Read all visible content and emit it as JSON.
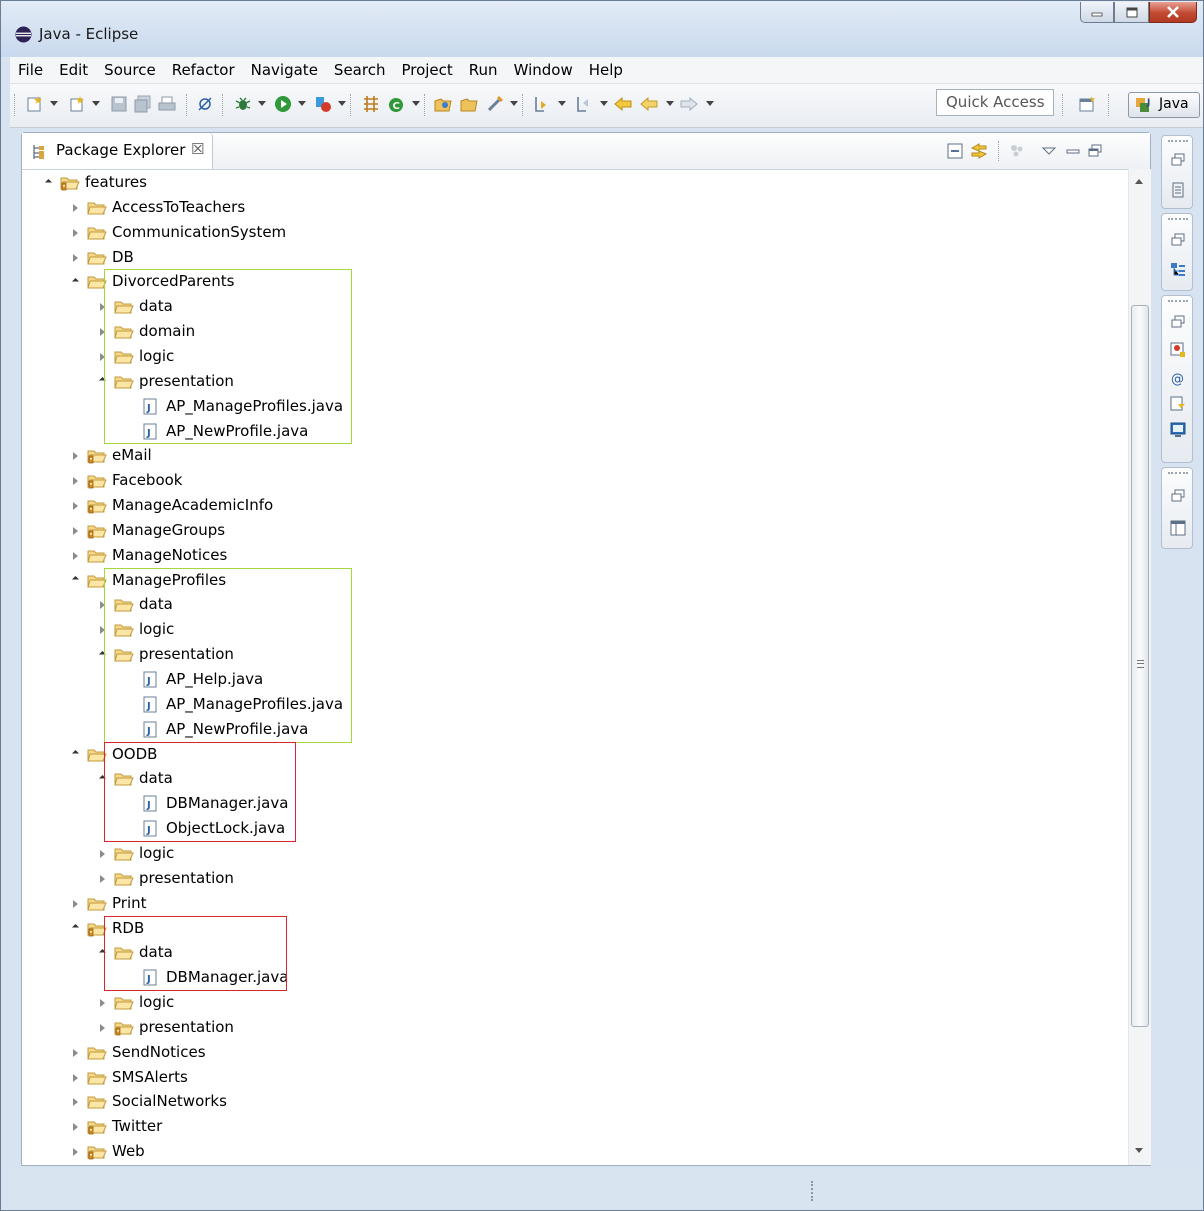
{
  "window": {
    "title": "Java - Eclipse",
    "controls": [
      "minimize-icon",
      "maximize-icon",
      "close-icon"
    ]
  },
  "menubar": [
    "File",
    "Edit",
    "Source",
    "Refactor",
    "Navigate",
    "Search",
    "Project",
    "Run",
    "Window",
    "Help"
  ],
  "toolbar": {
    "quick_access_placeholder": "Quick Access",
    "perspective_label": "Java"
  },
  "package_explorer": {
    "tab_label": "Package Explorer",
    "close_glyph": "☒"
  },
  "tree": [
    {
      "label": "features",
      "kind": "package-root",
      "depth": 0,
      "expanded": true
    },
    {
      "label": "AccessToTeachers",
      "kind": "folder",
      "depth": 1,
      "expanded": false
    },
    {
      "label": "CommunicationSystem",
      "kind": "folder",
      "depth": 1,
      "expanded": false
    },
    {
      "label": "DB",
      "kind": "folder",
      "depth": 1,
      "expanded": false
    },
    {
      "label": "DivorcedParents",
      "kind": "folder",
      "depth": 1,
      "expanded": true
    },
    {
      "label": "data",
      "kind": "folder",
      "depth": 2,
      "expanded": false
    },
    {
      "label": "domain",
      "kind": "folder",
      "depth": 2,
      "expanded": false
    },
    {
      "label": "logic",
      "kind": "folder",
      "depth": 2,
      "expanded": false
    },
    {
      "label": "presentation",
      "kind": "folder",
      "depth": 2,
      "expanded": true
    },
    {
      "label": "AP_ManageProfiles.java",
      "kind": "java",
      "depth": 3
    },
    {
      "label": "AP_NewProfile.java",
      "kind": "java",
      "depth": 3
    },
    {
      "label": "eMail",
      "kind": "package-root",
      "depth": 1,
      "expanded": false
    },
    {
      "label": "Facebook",
      "kind": "package-root",
      "depth": 1,
      "expanded": false
    },
    {
      "label": "ManageAcademicInfo",
      "kind": "package-root",
      "depth": 1,
      "expanded": false
    },
    {
      "label": "ManageGroups",
      "kind": "package-root",
      "depth": 1,
      "expanded": false
    },
    {
      "label": "ManageNotices",
      "kind": "folder",
      "depth": 1,
      "expanded": false
    },
    {
      "label": "ManageProfiles",
      "kind": "folder",
      "depth": 1,
      "expanded": true
    },
    {
      "label": "data",
      "kind": "folder",
      "depth": 2,
      "expanded": false
    },
    {
      "label": "logic",
      "kind": "folder",
      "depth": 2,
      "expanded": false
    },
    {
      "label": "presentation",
      "kind": "folder",
      "depth": 2,
      "expanded": true
    },
    {
      "label": "AP_Help.java",
      "kind": "java",
      "depth": 3
    },
    {
      "label": "AP_ManageProfiles.java",
      "kind": "java",
      "depth": 3
    },
    {
      "label": "AP_NewProfile.java",
      "kind": "java",
      "depth": 3
    },
    {
      "label": "OODB",
      "kind": "folder",
      "depth": 1,
      "expanded": true
    },
    {
      "label": "data",
      "kind": "folder",
      "depth": 2,
      "expanded": true
    },
    {
      "label": "DBManager.java",
      "kind": "java",
      "depth": 3
    },
    {
      "label": "ObjectLock.java",
      "kind": "java",
      "depth": 3
    },
    {
      "label": "logic",
      "kind": "folder",
      "depth": 2,
      "expanded": false
    },
    {
      "label": "presentation",
      "kind": "folder",
      "depth": 2,
      "expanded": false
    },
    {
      "label": "Print",
      "kind": "folder",
      "depth": 1,
      "expanded": false
    },
    {
      "label": "RDB",
      "kind": "package-root",
      "depth": 1,
      "expanded": true
    },
    {
      "label": "data",
      "kind": "folder",
      "depth": 2,
      "expanded": true
    },
    {
      "label": "DBManager.java",
      "kind": "java",
      "depth": 3
    },
    {
      "label": "logic",
      "kind": "folder",
      "depth": 2,
      "expanded": false
    },
    {
      "label": "presentation",
      "kind": "package-root",
      "depth": 2,
      "expanded": false
    },
    {
      "label": "SendNotices",
      "kind": "folder",
      "depth": 1,
      "expanded": false
    },
    {
      "label": "SMSAlerts",
      "kind": "folder",
      "depth": 1,
      "expanded": false
    },
    {
      "label": "SocialNetworks",
      "kind": "folder",
      "depth": 1,
      "expanded": false
    },
    {
      "label": "Twitter",
      "kind": "package-root",
      "depth": 1,
      "expanded": false
    },
    {
      "label": "Web",
      "kind": "package-root",
      "depth": 1,
      "expanded": false
    }
  ],
  "highlights": [
    {
      "group": "DivorcedParents",
      "color": "#a6d83a"
    },
    {
      "group": "ManageProfiles",
      "color": "#a6d83a"
    },
    {
      "group": "OODB",
      "color": "#d9262c"
    },
    {
      "group": "RDB",
      "color": "#d9262c"
    }
  ]
}
